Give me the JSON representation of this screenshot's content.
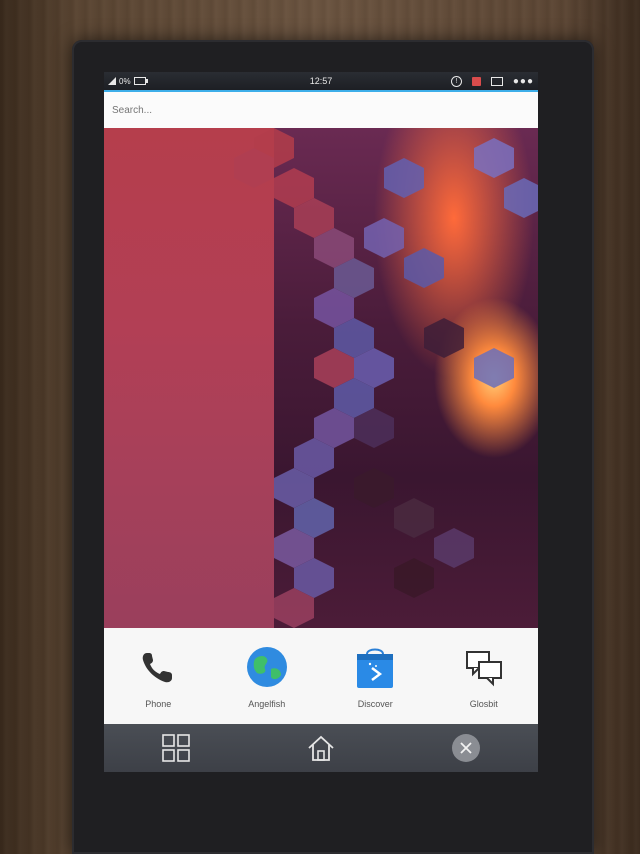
{
  "status_bar": {
    "battery_text": "0%",
    "time": "12:57",
    "icons": [
      "signal-icon",
      "battery-icon",
      "info-icon",
      "alert-icon",
      "screen-icon",
      "more-icon"
    ],
    "more_glyph": "●●●"
  },
  "search": {
    "placeholder": "Search..."
  },
  "dock": {
    "apps": [
      {
        "name": "phone-icon",
        "label": "Phone"
      },
      {
        "name": "globe-icon",
        "label": "Angelfish"
      },
      {
        "name": "shopping-bag-icon",
        "label": "Discover"
      },
      {
        "name": "chat-bubbles-icon",
        "label": "Glosbit"
      }
    ]
  },
  "navbar": {
    "items": [
      "app-grid-icon",
      "home-icon",
      "close-icon"
    ]
  },
  "colors": {
    "accent": "#3daee9",
    "wallpaper_red": "#b53e4c",
    "dock_bg": "#f7f7f7",
    "navbar_bg": "#45484f"
  }
}
